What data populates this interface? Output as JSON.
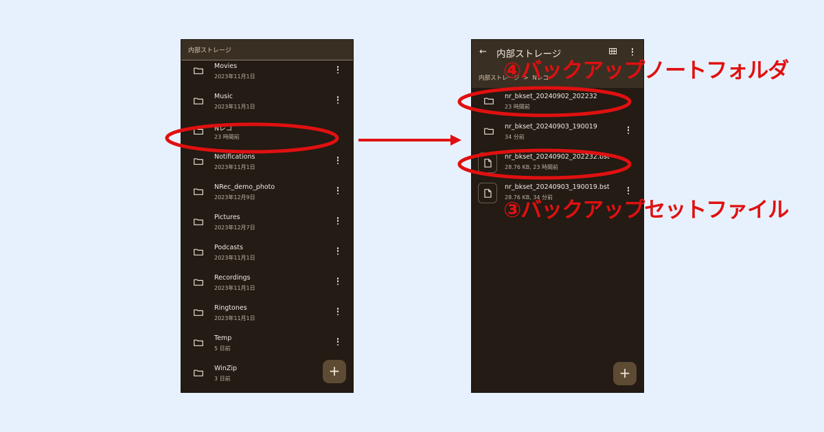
{
  "left_screen": {
    "header_title": "内部ストレージ",
    "items": [
      {
        "name": "Movies",
        "meta": "2023年11月1日",
        "menu": true
      },
      {
        "name": "Music",
        "meta": "2023年11月1日",
        "menu": true
      },
      {
        "name": "Nレコ",
        "meta": "23 時間前",
        "menu": false
      },
      {
        "name": "Notifications",
        "meta": "2023年11月1日",
        "menu": true
      },
      {
        "name": "NRec_demo_photo",
        "meta": "2023年12月9日",
        "menu": true
      },
      {
        "name": "Pictures",
        "meta": "2023年12月7日",
        "menu": true
      },
      {
        "name": "Podcasts",
        "meta": "2023年11月1日",
        "menu": true
      },
      {
        "name": "Recordings",
        "meta": "2023年11月1日",
        "menu": true
      },
      {
        "name": "Ringtones",
        "meta": "2023年11月1日",
        "menu": true
      },
      {
        "name": "Temp",
        "meta": "5 日前",
        "menu": true
      },
      {
        "name": "WinZip",
        "meta": "3 日前",
        "menu": false
      }
    ],
    "fab_label": "+"
  },
  "right_screen": {
    "back_icon": "←",
    "title": "内部ストレージ",
    "breadcrumb": [
      "内部ストレージ",
      "Nレコ"
    ],
    "breadcrumb_separator": ">",
    "items": [
      {
        "type": "folder",
        "name": "nr_bkset_20240902_202232",
        "meta": "23 時間前",
        "menu": false
      },
      {
        "type": "folder",
        "name": "nr_bkset_20240903_190019",
        "meta": "34 分前",
        "menu": true
      },
      {
        "type": "file",
        "name": "nr_bkset_20240902_202232.bst",
        "meta": "28.76 KB, 23 時間前",
        "menu": false
      },
      {
        "type": "file",
        "name": "nr_bkset_20240903_190019.bst",
        "meta": "28.76 KB, 34 分前",
        "menu": true
      }
    ],
    "fab_label": "+"
  },
  "annotations": {
    "label_backup_note_folder": "④バックアップノートフォルダ",
    "label_backup_set_file": "③バックアップセットファイル"
  },
  "colors": {
    "background": "#e6f1fd",
    "phone_bg": "#231b14",
    "header_bg": "#3a2f23",
    "annotation_red": "#e01010"
  }
}
